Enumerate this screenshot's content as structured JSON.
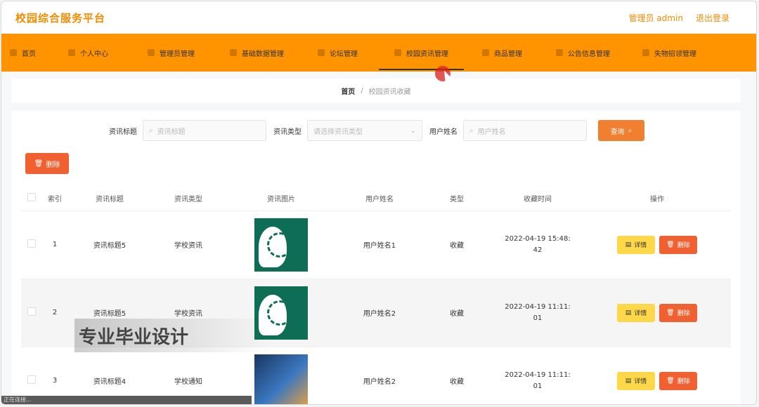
{
  "header": {
    "brand": "校园综合服务平台",
    "admin_label": "管理员 admin",
    "logout_label": "退出登录"
  },
  "nav": {
    "items": [
      {
        "label": "首页",
        "icon": "home-icon"
      },
      {
        "label": "个人中心",
        "icon": "user-icon"
      },
      {
        "label": "管理员管理",
        "icon": "admin-icon"
      },
      {
        "label": "基础数据管理",
        "icon": "data-icon"
      },
      {
        "label": "论坛管理",
        "icon": "forum-icon"
      },
      {
        "label": "校园资讯管理",
        "icon": "news-icon"
      },
      {
        "label": "商品管理",
        "icon": "goods-icon"
      },
      {
        "label": "公告信息管理",
        "icon": "notice-icon"
      },
      {
        "label": "失物招领管理",
        "icon": "lost-found-icon"
      }
    ],
    "active": "校园资讯管理"
  },
  "breadcrumb": {
    "home": "首页",
    "sep": "/",
    "current": "校园资讯收藏"
  },
  "search": {
    "title_label": "资讯标题",
    "title_placeholder": "资讯标题",
    "type_label": "资讯类型",
    "type_placeholder": "请选择资讯类型",
    "user_label": "用户姓名",
    "user_placeholder": "用户姓名",
    "query_button": "查询"
  },
  "toolbar": {
    "delete_label": "删除"
  },
  "table": {
    "headers": [
      "索引",
      "资讯标题",
      "资讯类型",
      "资讯图片",
      "用户姓名",
      "类型",
      "收藏时间",
      "操作"
    ],
    "rows": [
      {
        "index": "1",
        "title": "资讯标题5",
        "type": "学校资讯",
        "image": "brain-image",
        "user": "用户姓名1",
        "kind": "收藏",
        "time1": "2022-04-19 15:48:",
        "time2": "42"
      },
      {
        "index": "2",
        "title": "资讯标题5",
        "type": "学校资讯",
        "image": "brain-image",
        "user": "用户姓名2",
        "kind": "收藏",
        "time1": "2022-04-19 11:11:",
        "time2": "01"
      },
      {
        "index": "3",
        "title": "资讯标题4",
        "type": "学校通知",
        "image": "tech-image",
        "user": "用户姓名2",
        "kind": "收藏",
        "time1": "2022-04-19 11:11:",
        "time2": "01"
      }
    ],
    "detail_label": "详情",
    "delete_label": "删除"
  },
  "overlay": {
    "watermark": "专业毕业设计"
  },
  "statusbar": {
    "text": "正在连接..."
  },
  "colors": {
    "accent": "#ff9300",
    "brand": "#f08c00",
    "danger": "#f06030",
    "warning": "#ffd84a"
  }
}
